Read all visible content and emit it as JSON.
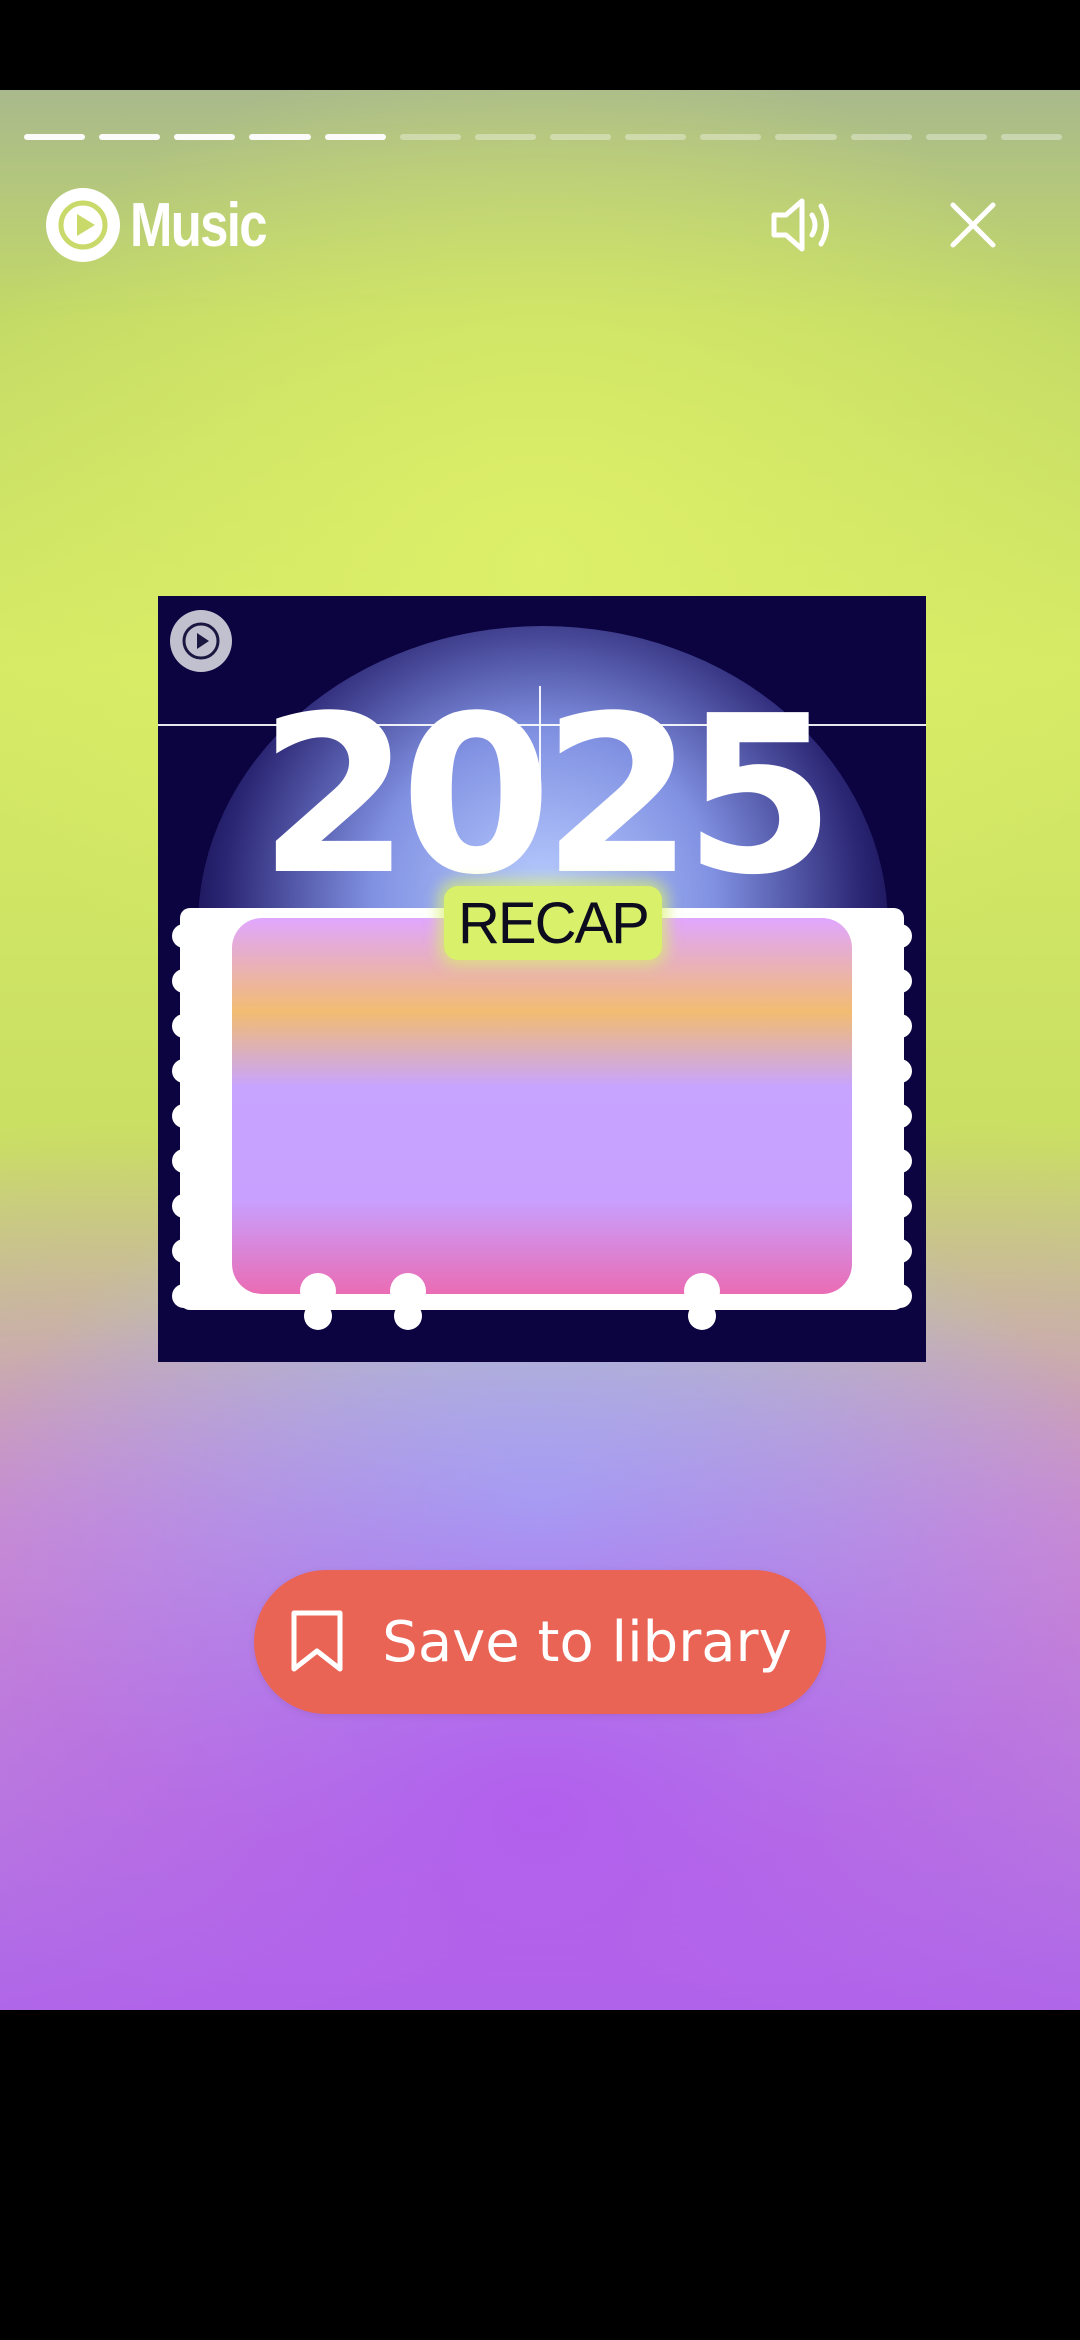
{
  "header": {
    "logo_text": "Music",
    "logo_icon": "youtube-music-play-icon",
    "sound_icon": "speaker-icon",
    "close_icon": "close-icon"
  },
  "progress": {
    "total_segments": 14,
    "completed_segments": 5
  },
  "album_art": {
    "year": "2025",
    "badge": "RECAP",
    "corner_icon": "play-icon"
  },
  "save_button": {
    "label": "Save to library",
    "icon": "bookmark-icon",
    "color": "#ea6456"
  },
  "colors": {
    "accent_green": "#d6ea66",
    "accent_purple": "#b06ae6",
    "album_bg": "#0b0440"
  }
}
